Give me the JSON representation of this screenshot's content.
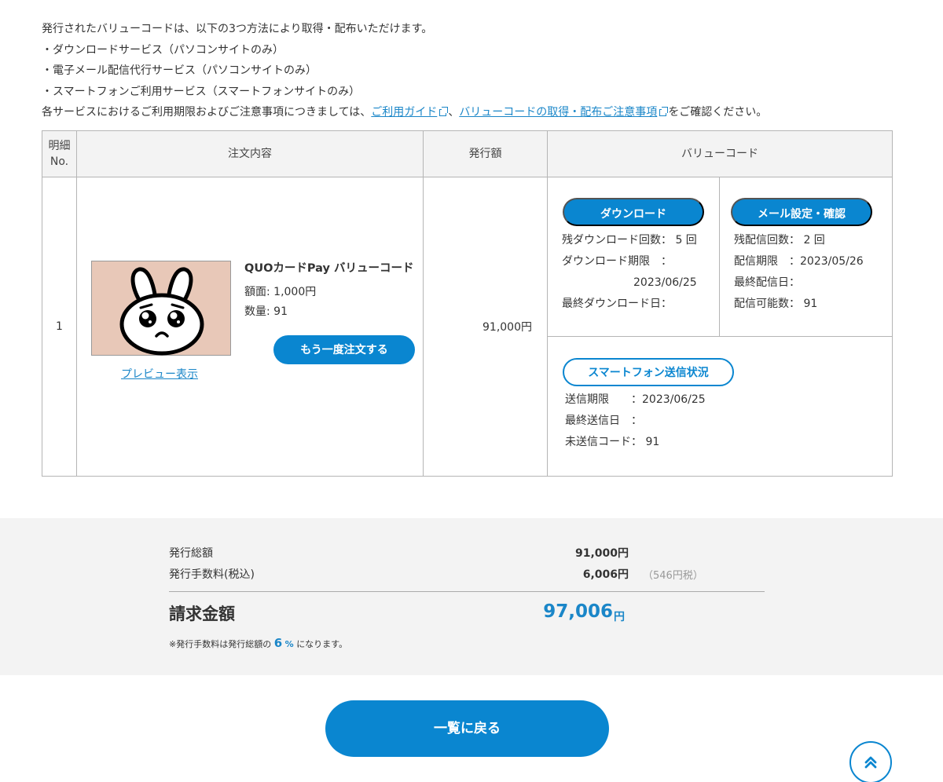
{
  "intro": {
    "line1": "発行されたバリューコードは、以下の3つ方法により取得・配布いただけます。",
    "line2": "・ダウンロードサービス（パソコンサイトのみ）",
    "line3": "・電子メール配信代行サービス（パソコンサイトのみ）",
    "line4": "・スマートフォンご利用サービス（スマートフォンサイトのみ）",
    "line5_prefix": "各サービスにおけるご利用期限およびご注意事項につきましては、",
    "link_guide": "ご利用ガイド",
    "line5_sep": "、",
    "link_notes": "バリューコードの取得・配布ご注意事項",
    "line5_suffix": "をご確認ください。"
  },
  "table": {
    "headers": {
      "no_line1": "明細",
      "no_line2": "No.",
      "content": "注文内容",
      "amount": "発行額",
      "value_code": "バリューコード"
    },
    "row": {
      "no": "1",
      "product_name": "QUOカードPay バリューコード",
      "face_value": "額面: 1,000円",
      "quantity": "数量: 91",
      "reorder_label": "もう一度注文する",
      "preview_label": "プレビュー表示",
      "amount": "91,000円"
    }
  },
  "download": {
    "button_label": "ダウンロード",
    "remaining": "残ダウンロード回数： 5 回",
    "deadline_label": "ダウンロード期限　：",
    "deadline_value": "2023/06/25",
    "last_date": "最終ダウンロード日："
  },
  "mail": {
    "button_label": "メール設定・確認",
    "remaining": "残配信回数： 2 回",
    "deadline": "配信期限　：2023/05/26",
    "last_date": "最終配信日：",
    "available": "配信可能数： 91"
  },
  "smartphone": {
    "button_label": "スマートフォン送信状況",
    "deadline": "送信期限　　：2023/06/25",
    "last_date": "最終送信日　：",
    "unsent": "未送信コード： 91"
  },
  "summary": {
    "issue_total_label": "発行総額",
    "issue_total_value": "91,000円",
    "fee_label": "発行手数料(税込)",
    "fee_value": "6,006円",
    "fee_tax": "（546円税）",
    "invoice_label": "請求金額",
    "invoice_value": "97,006",
    "invoice_unit": "円",
    "note_prefix": "※発行手数料は発行総額の",
    "note_rate": "6",
    "note_pct": "%",
    "note_suffix": "になります。"
  },
  "footer": {
    "back_label": "一覧に戻る",
    "scroll_top_icon": "double-chevron-up-icon"
  },
  "colors": {
    "accent": "#0a86d0",
    "link": "#1a86c8",
    "thumb_bg": "#e8c8b8",
    "summary_bg": "#f3f3f3"
  }
}
